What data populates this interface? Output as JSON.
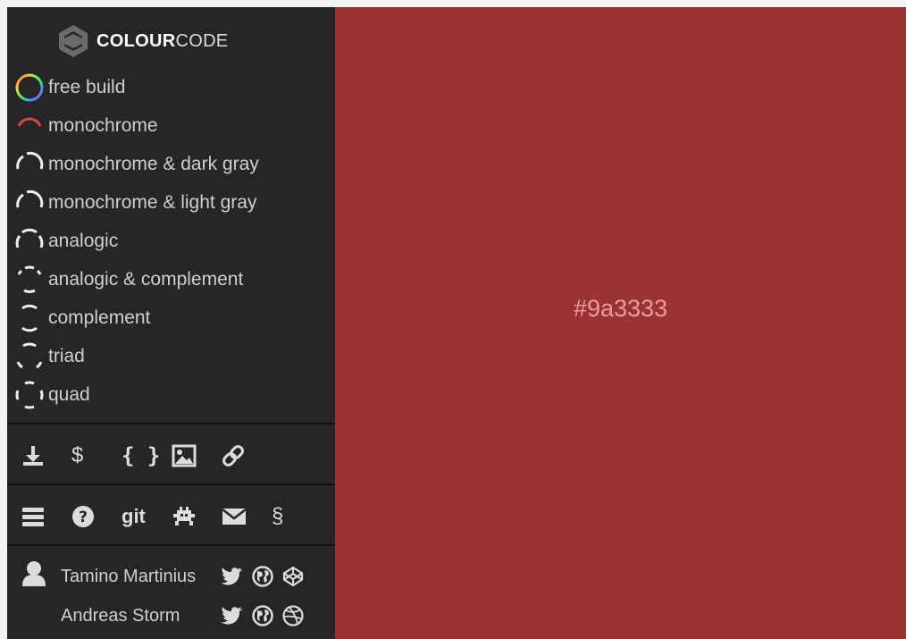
{
  "app": {
    "brand_bold": "COLOUR",
    "brand_light": "CODE"
  },
  "modes": [
    {
      "label": "free build",
      "icon": "color-wheel-icon"
    },
    {
      "label": "monochrome",
      "icon": "monochrome-icon"
    },
    {
      "label": "monochrome & dark gray",
      "icon": "monochrome-dark-gray-icon"
    },
    {
      "label": "monochrome & light gray",
      "icon": "monochrome-light-gray-icon"
    },
    {
      "label": "analogic",
      "icon": "analogic-icon"
    },
    {
      "label": "analogic & complement",
      "icon": "analogic-complement-icon"
    },
    {
      "label": "complement",
      "icon": "complement-icon"
    },
    {
      "label": "triad",
      "icon": "triad-icon"
    },
    {
      "label": "quad",
      "icon": "quad-icon"
    }
  ],
  "export_tools": [
    {
      "icon": "download-icon"
    },
    {
      "icon": "dollar-icon",
      "glyph": "$"
    },
    {
      "icon": "code-braces-icon",
      "glyph": "{ }"
    },
    {
      "icon": "image-icon"
    },
    {
      "icon": "link-icon"
    }
  ],
  "info_tools": [
    {
      "icon": "menu-icon"
    },
    {
      "icon": "help-icon"
    },
    {
      "icon": "git-icon",
      "glyph": "git"
    },
    {
      "icon": "bug-icon"
    },
    {
      "icon": "mail-icon"
    },
    {
      "icon": "section-icon",
      "glyph": "§"
    }
  ],
  "credits": [
    {
      "name": "Tamino Martinius",
      "socials": [
        "twitter-icon",
        "globe-icon",
        "codepen-icon"
      ]
    },
    {
      "name": "Andreas Storm",
      "socials": [
        "twitter-icon",
        "globe-icon",
        "dribbble-icon"
      ]
    }
  ],
  "canvas": {
    "color_label": "#9a3333"
  },
  "colors": {
    "background": "#9a3333",
    "label": "#f09a9a",
    "sidebar": "#262626"
  }
}
